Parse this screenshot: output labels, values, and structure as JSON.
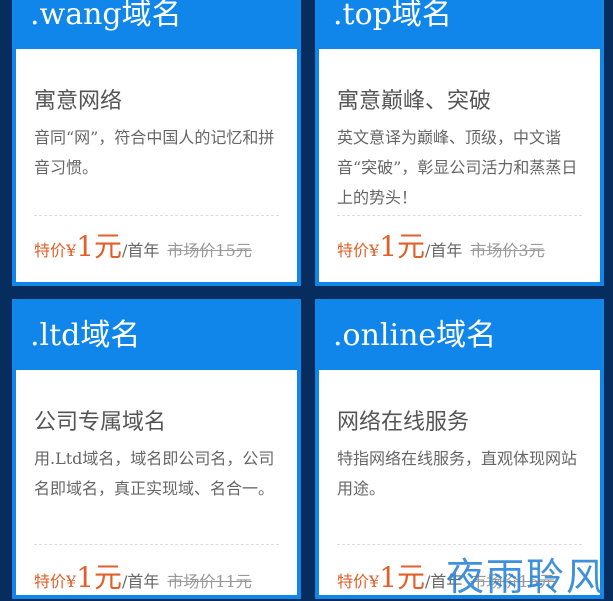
{
  "cards": [
    {
      "title": ".wang域名",
      "subtitle": "寓意网络",
      "desc": "音同“网”，符合中国人的记忆和拼音习惯。",
      "price_prefix": "特价¥",
      "price_value": "1元",
      "price_unit": "/首年",
      "market_price": "市场价15元"
    },
    {
      "title": ".top域名",
      "subtitle": "寓意巅峰、突破",
      "desc": "英文意译为巅峰、顶级，中文谐音“突破”，彰显公司活力和蒸蒸日上的势头！",
      "price_prefix": "特价¥",
      "price_value": "1元",
      "price_unit": "/首年",
      "market_price": "市场价3元"
    },
    {
      "title": ".ltd域名",
      "subtitle": "公司专属域名",
      "desc": "用.Ltd域名，域名即公司名，公司名即域名，真正实现域、名合一。",
      "price_prefix": "特价¥",
      "price_value": "1元",
      "price_unit": "/首年",
      "market_price": "市场价11元"
    },
    {
      "title": ".online域名",
      "subtitle": "网络在线服务",
      "desc": "特指网络在线服务，直观体现网站用途。",
      "price_prefix": "特价¥",
      "price_value": "1元",
      "price_unit": "/首年",
      "market_price": "市场价15元"
    }
  ],
  "watermark": "夜雨聆风",
  "colors": {
    "background": "#062d5e",
    "card_header": "#1086ea",
    "price_accent": "#e25f29"
  }
}
